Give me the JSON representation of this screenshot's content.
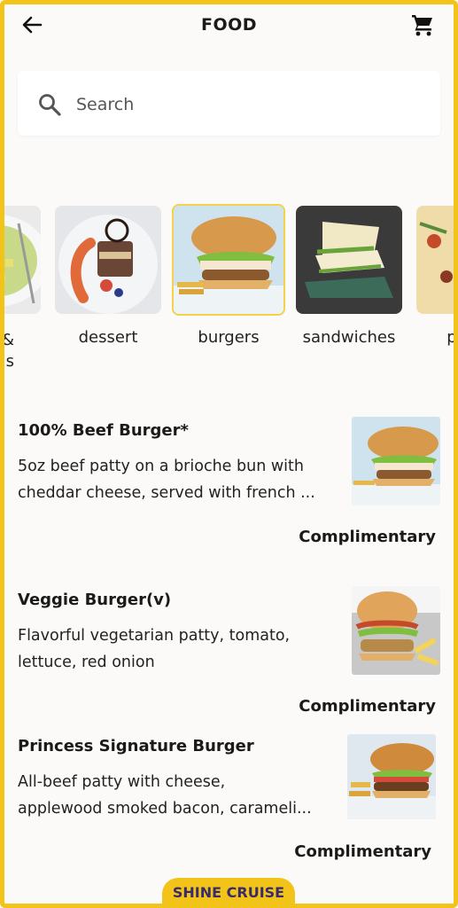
{
  "header": {
    "title": "FOOD"
  },
  "search": {
    "placeholder": "Search"
  },
  "categories": [
    {
      "label": "&\ns",
      "icon": "salad-image"
    },
    {
      "label": "dessert",
      "icon": "dessert-image"
    },
    {
      "label": "burgers",
      "icon": "burger-image",
      "selected": true
    },
    {
      "label": "sandwiches",
      "icon": "sandwich-image"
    },
    {
      "label": "p",
      "icon": "pizza-image"
    }
  ],
  "items": [
    {
      "name": "100% Beef Burger*",
      "desc1": "5oz beef patty on a brioche bun with",
      "desc2": "cheddar cheese, served with french ...",
      "price": "Complimentary"
    },
    {
      "name": "Veggie Burger(v)",
      "desc1": "Flavorful vegetarian patty, tomato,",
      "desc2": "lettuce, red onion",
      "price": "Complimentary"
    },
    {
      "name": "Princess Signature Burger",
      "desc1": "All-beef patty with cheese,",
      "desc2": "applewood smoked bacon, carameli...",
      "price": "Complimentary"
    }
  ],
  "brand": "SHINE CRUISE",
  "colors": {
    "accent": "#f2c318",
    "selected_border": "#f2d24a"
  }
}
